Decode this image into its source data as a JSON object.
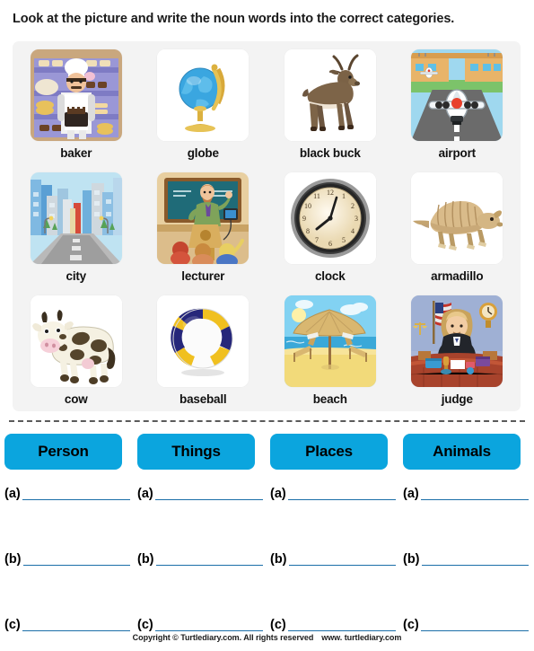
{
  "instruction": "Look at the picture and write the noun words into the correct categories.",
  "pictures": [
    {
      "label": "baker",
      "icon": "baker-illustration"
    },
    {
      "label": "globe",
      "icon": "globe-illustration"
    },
    {
      "label": "black buck",
      "icon": "black-buck-illustration"
    },
    {
      "label": "airport",
      "icon": "airport-illustration"
    },
    {
      "label": "city",
      "icon": "city-illustration"
    },
    {
      "label": "lecturer",
      "icon": "lecturer-illustration"
    },
    {
      "label": "clock",
      "icon": "clock-illustration"
    },
    {
      "label": "armadillo",
      "icon": "armadillo-illustration"
    },
    {
      "label": "cow",
      "icon": "cow-illustration"
    },
    {
      "label": "baseball",
      "icon": "baseball-illustration"
    },
    {
      "label": "beach",
      "icon": "beach-illustration"
    },
    {
      "label": "judge",
      "icon": "judge-illustration"
    }
  ],
  "categories": [
    {
      "label": "Person",
      "answers": [
        "(a)",
        "(b)",
        "(c)"
      ]
    },
    {
      "label": "Things",
      "answers": [
        "(a)",
        "(b)",
        "(c)"
      ]
    },
    {
      "label": "Places",
      "answers": [
        "(a)",
        "(b)",
        "(c)"
      ]
    },
    {
      "label": "Animals",
      "answers": [
        "(a)",
        "(b)",
        "(c)"
      ]
    }
  ],
  "colors": {
    "category_button": "#0BA5DE",
    "answer_line": "#1b6fa8",
    "panel_background": "#f3f3f3",
    "divider": "#5a5a5a"
  },
  "footer": {
    "copyright": "Copyright © Turtlediary.com. All rights reserved",
    "website": "www. turtlediary.com"
  }
}
